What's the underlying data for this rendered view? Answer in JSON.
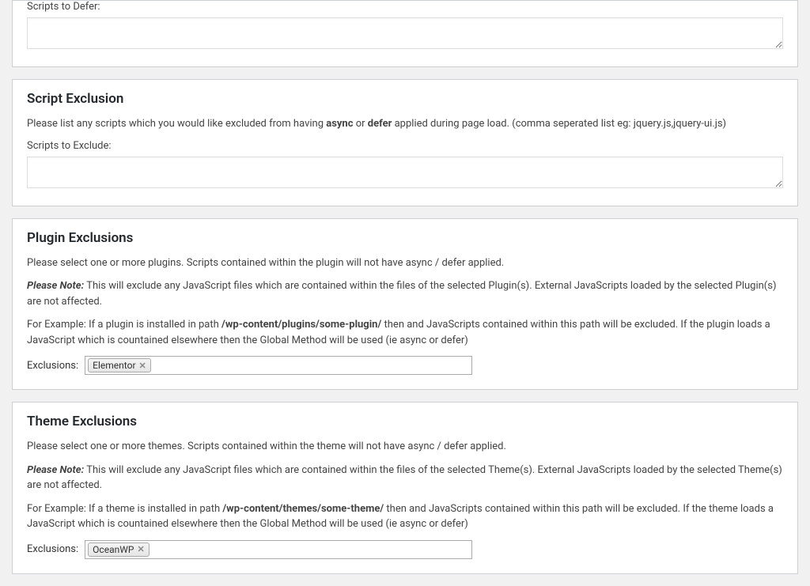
{
  "section1": {
    "defer_label": "Scripts to Defer:",
    "defer_value": ""
  },
  "section2": {
    "heading": "Script Exclusion",
    "desc_prefix": "Please list any scripts which you would like excluded from having ",
    "desc_bold1": "async",
    "desc_mid": " or ",
    "desc_bold2": "defer",
    "desc_suffix": " applied during page load. (comma seperated list eg: jquery.js,jquery-ui.js)",
    "exclude_label": "Scripts to Exclude:",
    "exclude_value": ""
  },
  "section3": {
    "heading": "Plugin Exclusions",
    "desc": "Please select one or more plugins. Scripts contained within the plugin will not have async / defer applied.",
    "note_label": "Please Note:",
    "note_text": " This will exclude any JavaScript files which are contained within the files of the selected Plugin(s). External JavaScripts loaded by the selected Plugin(s) are not affected.",
    "example_prefix": "For Example: If a plugin is installed in path ",
    "example_bold": "/wp-content/plugins/some-plugin/",
    "example_suffix": " then and JavaScripts contained within this path will be excluded. If the plugin loads a JavaScript which is countained elsewhere then the Global Method will be used (ie async or defer)",
    "exclusions_label": "Exclusions:",
    "token": "Elementor"
  },
  "section4": {
    "heading": "Theme Exclusions",
    "desc": "Please select one or more themes. Scripts contained within the theme will not have async / defer applied.",
    "note_label": "Please Note:",
    "note_text": " This will exclude any JavaScript files which are contained within the files of the selected Theme(s). External JavaScripts loaded by the selected Theme(s) are not affected.",
    "example_prefix": "For Example: If a theme is installed in path ",
    "example_bold": "/wp-content/themes/some-theme/",
    "example_suffix": " then and JavaScripts contained within this path will be excluded. If the theme loads a JavaScript which is countained elsewhere then the Global Method will be used (ie async or defer)",
    "exclusions_label": "Exclusions:",
    "token": "OceanWP"
  },
  "icons": {
    "remove": "✕"
  }
}
